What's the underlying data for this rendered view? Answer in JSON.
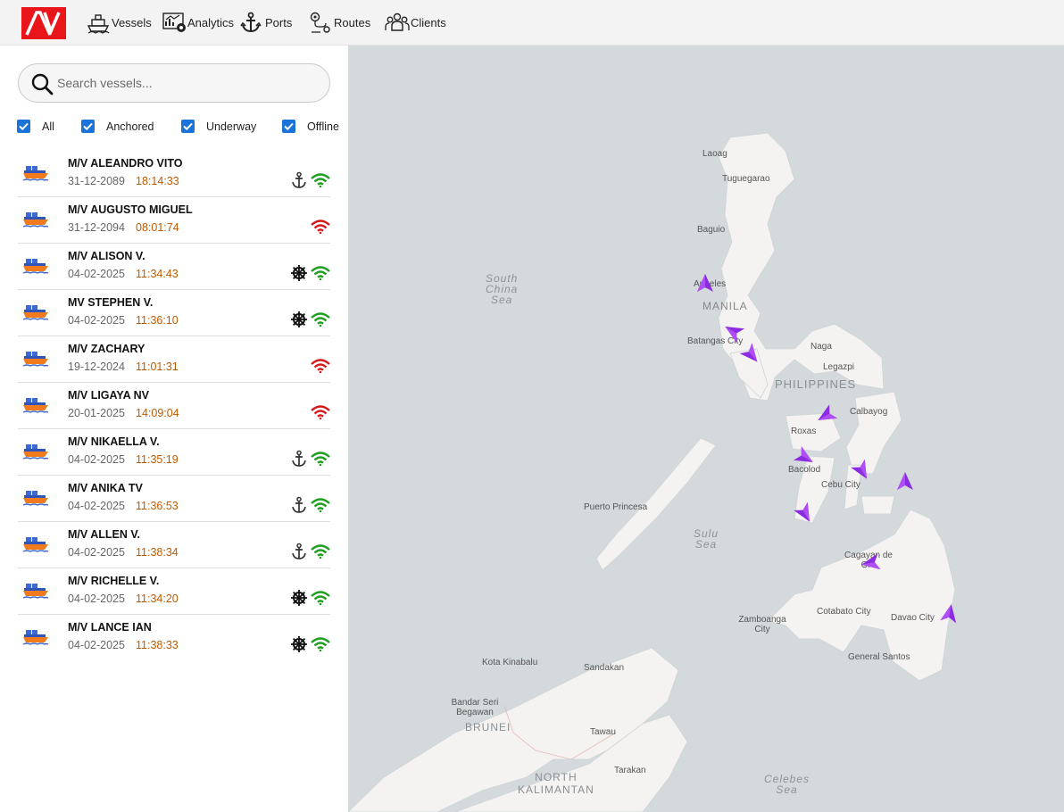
{
  "app": {
    "logo_text": "AV",
    "nav": [
      {
        "label": "Vessels",
        "icon": "ship-icon"
      },
      {
        "label": "Analytics",
        "icon": "analytics-icon"
      },
      {
        "label": "Ports",
        "icon": "anchor-icon"
      },
      {
        "label": "Routes",
        "icon": "route-icon"
      },
      {
        "label": "Clients",
        "icon": "clients-icon"
      }
    ]
  },
  "search": {
    "placeholder": "Search vessels..."
  },
  "filters": [
    {
      "label": "All",
      "checked": true
    },
    {
      "label": "Anchored",
      "checked": true
    },
    {
      "label": "Underway",
      "checked": true
    },
    {
      "label": "Offline",
      "checked": true
    }
  ],
  "vessels": [
    {
      "name": "M/V ALEANDRO VITO",
      "date": "31-12-2089",
      "time": "18:14:33",
      "status": "anchored",
      "signal": "online"
    },
    {
      "name": "M/V AUGUSTO MIGUEL",
      "date": "31-12-2094",
      "time": "08:01:74",
      "status": "none",
      "signal": "offline"
    },
    {
      "name": "M/V ALISON V.",
      "date": "04-02-2025",
      "time": "11:34:43",
      "status": "underway",
      "signal": "online"
    },
    {
      "name": "MV STEPHEN V.",
      "date": "04-02-2025",
      "time": "11:36:10",
      "status": "underway",
      "signal": "online"
    },
    {
      "name": "M/V ZACHARY",
      "date": "19-12-2024",
      "time": "11:01:31",
      "status": "none",
      "signal": "offline"
    },
    {
      "name": "M/V LIGAYA NV",
      "date": "20-01-2025",
      "time": "14:09:04",
      "status": "none",
      "signal": "offline"
    },
    {
      "name": "M/V NIKAELLA V.",
      "date": "04-02-2025",
      "time": "11:35:19",
      "status": "anchored",
      "signal": "online"
    },
    {
      "name": "M/V ANIKA TV",
      "date": "04-02-2025",
      "time": "11:36:53",
      "status": "anchored",
      "signal": "online"
    },
    {
      "name": "M/V ALLEN V.",
      "date": "04-02-2025",
      "time": "11:38:34",
      "status": "anchored",
      "signal": "online"
    },
    {
      "name": "M/V RICHELLE V.",
      "date": "04-02-2025",
      "time": "11:34:20",
      "status": "underway",
      "signal": "online"
    },
    {
      "name": "M/V LANCE IAN",
      "date": "04-02-2025",
      "time": "11:38:33",
      "status": "underway",
      "signal": "online"
    }
  ],
  "map": {
    "country_label": "PHILIPPINES",
    "capital_label": "MANILA",
    "sea_labels": [
      "South\nChina\nSea",
      "Sulu\nSea",
      "Celebes\nSea"
    ],
    "places": [
      "Laoag",
      "Tuguegarao",
      "Baguio",
      "Angeles",
      "Batangas City",
      "Naga",
      "Legazpi",
      "Calbayog",
      "Roxas",
      "Bacolod",
      "Cebu City",
      "Puerto Princesa",
      "Cagayan de Oro",
      "Cotabato City",
      "Davao City",
      "Zamboanga City",
      "General Santos",
      "Kota Kinabalu",
      "Sandakan",
      "Bandar Seri Begawan",
      "Tawau",
      "Tarakan"
    ],
    "other_countries": [
      "BRUNEI",
      "NORTH\nKALIMANTAN"
    ],
    "marker_color": "#8b2be2"
  },
  "colors": {
    "accent": "#1a73d9",
    "brand": "#e8161b",
    "time": "#c05a00",
    "online": "#1e9e1e",
    "offline": "#d41a1a"
  }
}
